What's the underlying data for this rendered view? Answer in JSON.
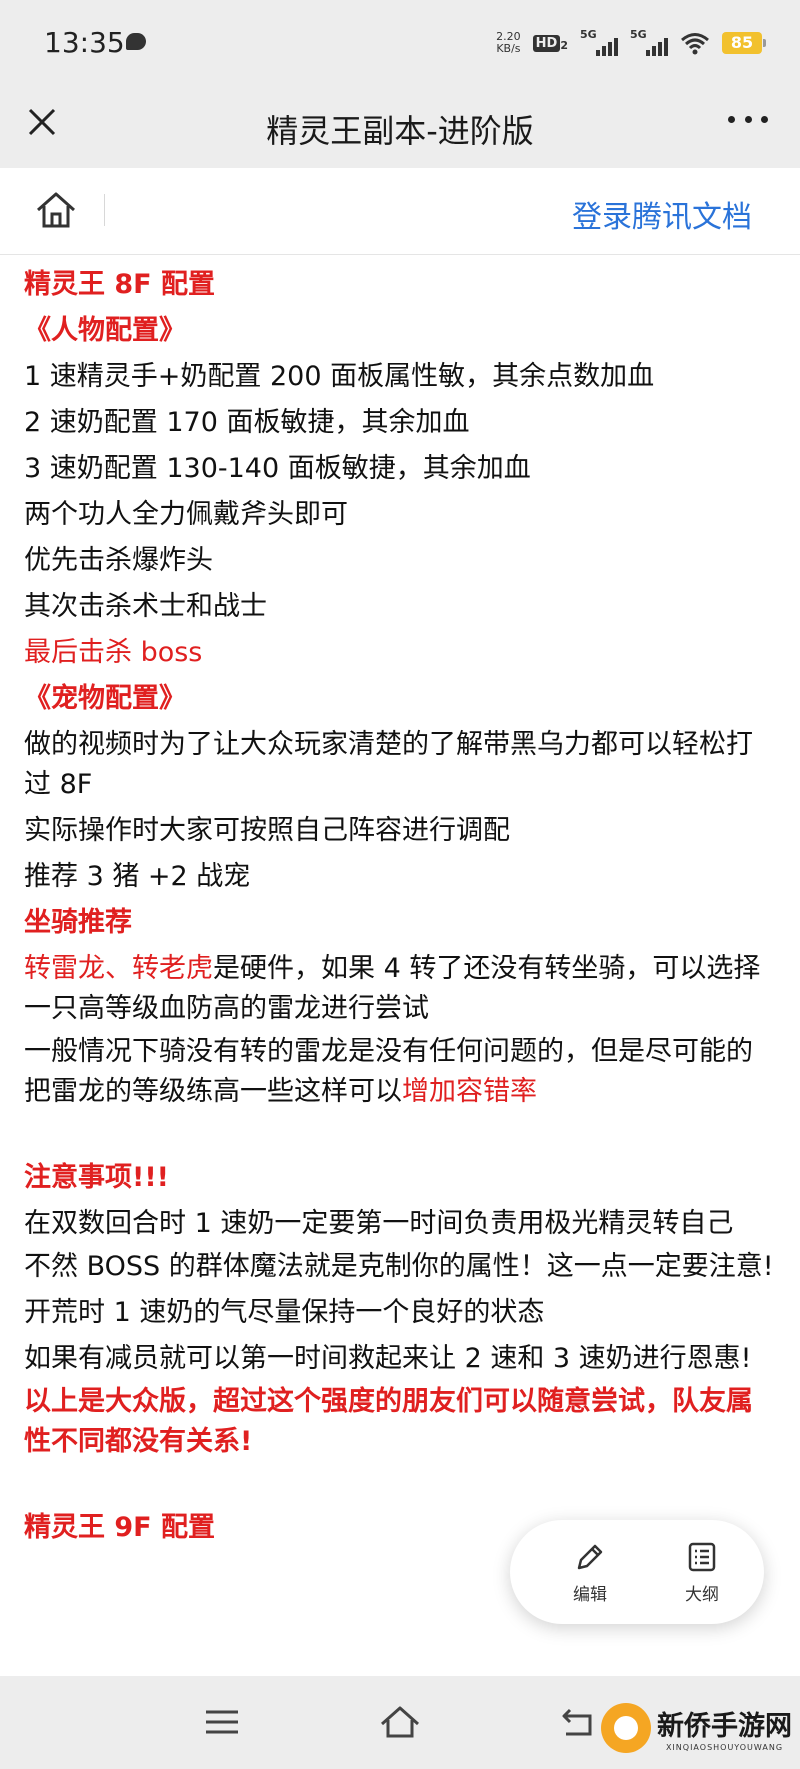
{
  "status_bar": {
    "time": "13:35",
    "net_speed_value": "2.20",
    "net_speed_unit": "KB/s",
    "hd_label": "HD",
    "hd_sub": "2",
    "signal1_label": "5G",
    "signal2_label": "5G",
    "battery": "85"
  },
  "title_bar": {
    "title": "精灵王副本-进阶版"
  },
  "toolbar": {
    "login_label": "登录腾讯文档"
  },
  "content": {
    "l1": "精灵王 8F 配置",
    "l2": "《人物配置》",
    "l3": "1 速精灵手+奶配置 200 面板属性敏，其余点数加血",
    "l4": "2 速奶配置 170 面板敏捷，其余加血",
    "l5": "3 速奶配置 130-140 面板敏捷，其余加血",
    "l6": "两个功人全力佩戴斧头即可",
    "l7": "优先击杀爆炸头",
    "l8": "其次击杀术士和战士",
    "l9": "最后击杀 boss",
    "l10": "《宠物配置》",
    "l11": "做的视频时为了让大众玩家清楚的了解带黑乌力都可以轻松打过 8F",
    "l12": "实际操作时大家可按照自己阵容进行调配",
    "l13": "推荐 3 猪 +2 战宠",
    "l14": "坐骑推荐",
    "l15_red": "转雷龙、转老虎",
    "l15_rest": "是硬件，如果 4 转了还没有转坐骑，可以选择一只高等级血防高的雷龙进行尝试",
    "l16_main": "一般情况下骑没有转的雷龙是没有任何问题的，但是尽可能的把雷龙的等级练高一些这样可以",
    "l16_red": "增加容错率",
    "l17": "注意事项!!!",
    "l18": "在双数回合时 1 速奶一定要第一时间负责用极光精灵转自己",
    "l19": "不然 BOSS 的群体魔法就是克制你的属性！这一点一定要注意!",
    "l20": "开荒时 1 速奶的气尽量保持一个良好的状态",
    "l21": "如果有减员就可以第一时间救起来让 2 速和 3 速奶进行恩惠!",
    "l22": "以上是大众版，超过这个强度的朋友们可以随意尝试，队友属性不同都没有关系!",
    "l23": "精灵王 9F 配置"
  },
  "float_menu": {
    "edit_label": "编辑",
    "outline_label": "大纲"
  },
  "watermark": {
    "main": "新侨手游网",
    "sub": "XINQIAOSHOUYOUWANG"
  },
  "colors": {
    "accent_red": "#e02020",
    "link_blue": "#2a73d9",
    "bar_gray": "#ededed"
  }
}
